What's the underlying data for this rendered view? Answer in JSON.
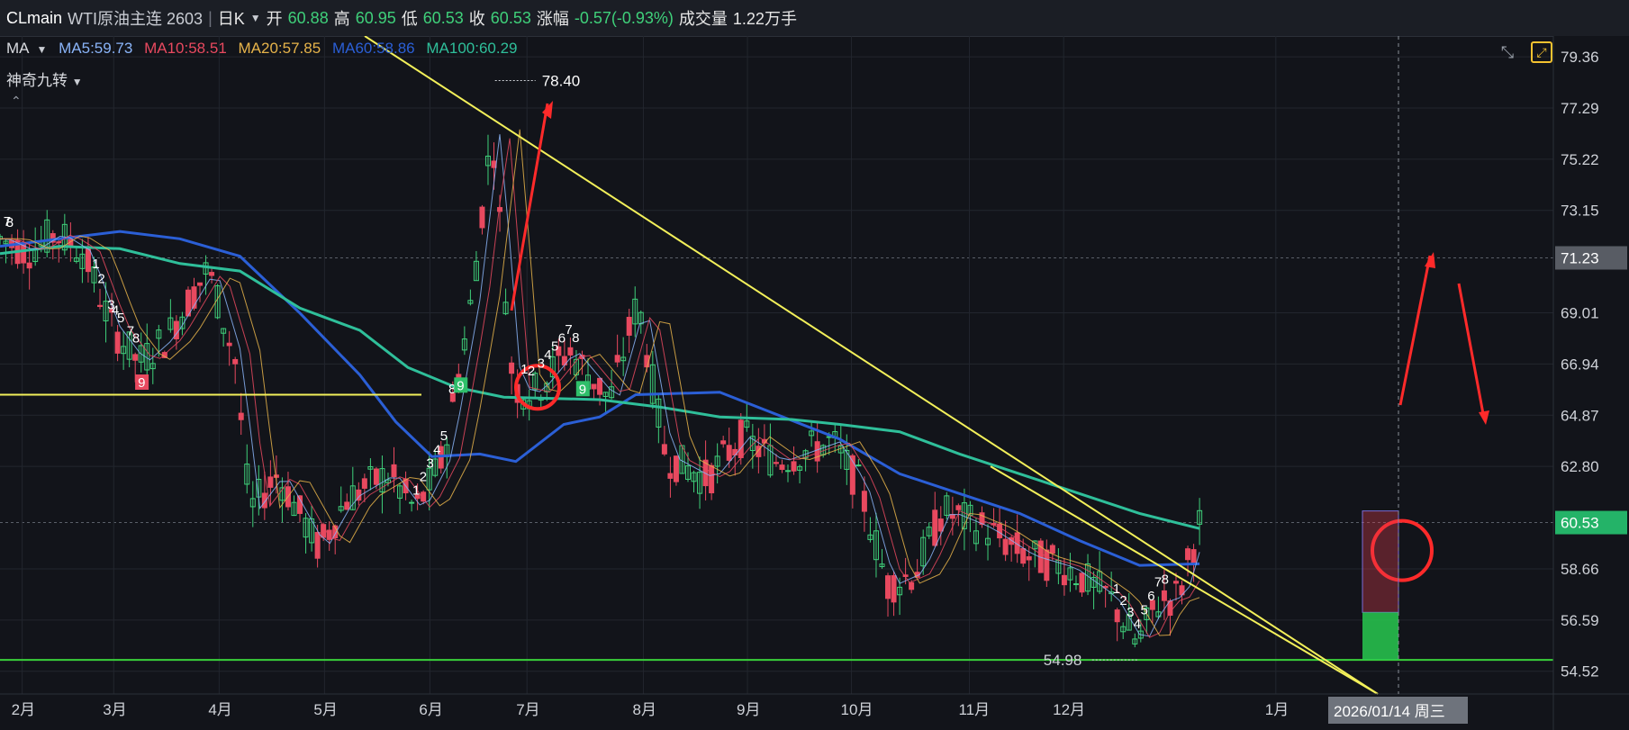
{
  "header": {
    "symbol": "CLmain",
    "name": "WTI原油主连 2603",
    "separator": "|",
    "period": "日K",
    "open_label": "开",
    "open": "60.88",
    "high_label": "高",
    "high": "60.95",
    "low_label": "低",
    "low": "60.53",
    "close_label": "收",
    "close": "60.53",
    "change_label": "涨幅",
    "change": "-0.57(-0.93%)",
    "volume_label": "成交量",
    "volume": "1.22万手"
  },
  "indicators": {
    "ma_label": "MA",
    "ma5": "MA5:59.73",
    "ma10": "MA10:58.51",
    "ma20": "MA20:57.85",
    "ma60": "MA60:58.86",
    "ma100": "MA100:60.29",
    "td_label": "神奇九转",
    "collapse_icon": "chevron-up-icon"
  },
  "colors": {
    "background": "#12141a",
    "up": "#3fd07a",
    "down": "#e8495f",
    "ma5": "#8ab4f8",
    "ma10": "#e8495f",
    "ma20": "#e6b34a",
    "ma60": "#2b5fd6",
    "ma100": "#2fbf9a",
    "trendline": "#f3f05a",
    "support": "#3ad13a",
    "annotation": "#ff2a2a"
  },
  "chart_data": {
    "type": "line",
    "ylim": [
      53.6,
      80.2
    ],
    "y_ticks": [
      "79.36",
      "77.29",
      "75.22",
      "73.15",
      "71.23",
      "69.01",
      "66.94",
      "64.87",
      "62.80",
      "60.53",
      "58.66",
      "56.59",
      "54.52"
    ],
    "highlighted_prices": [
      "71.23",
      "60.53"
    ],
    "x_ticks": [
      "2月",
      "3月",
      "4月",
      "5月",
      "6月",
      "7月",
      "8月",
      "9月",
      "10月",
      "11月",
      "12月",
      "1月"
    ],
    "crosshair_date": "2026/01/14 周三",
    "max_label": "78.40",
    "min_label": "54.98",
    "support_level": 54.98,
    "series": [
      {
        "name": "MA60",
        "x": [
          0,
          0.05,
          0.1,
          0.15,
          0.2,
          0.25,
          0.3,
          0.33,
          0.36,
          0.4,
          0.43,
          0.47,
          0.5,
          0.53,
          0.6,
          0.7,
          0.75,
          0.8,
          0.85,
          0.9,
          0.95,
          1.0
        ],
        "values": [
          71.7,
          72.0,
          72.3,
          72.0,
          71.3,
          69.0,
          66.5,
          64.6,
          63.2,
          63.3,
          63.0,
          64.5,
          64.8,
          65.7,
          65.8,
          63.9,
          62.5,
          61.7,
          60.9,
          59.8,
          58.8,
          58.86
        ]
      },
      {
        "name": "MA100",
        "x": [
          0,
          0.05,
          0.1,
          0.15,
          0.2,
          0.25,
          0.3,
          0.34,
          0.38,
          0.42,
          0.5,
          0.55,
          0.6,
          0.66,
          0.7,
          0.75,
          0.8,
          0.85,
          0.9,
          0.95,
          1.0
        ],
        "values": [
          71.4,
          71.7,
          71.6,
          71.0,
          70.7,
          69.2,
          68.3,
          66.8,
          66.0,
          65.6,
          65.5,
          65.2,
          64.8,
          64.7,
          64.5,
          64.2,
          63.3,
          62.5,
          61.7,
          60.9,
          60.29
        ]
      },
      {
        "name": "MA5",
        "x": [],
        "values": []
      }
    ],
    "candles_ohlc": "approx_daily",
    "td_marks": [
      {
        "x": 0.005,
        "text": "7"
      },
      {
        "x": 0.007,
        "text": "8"
      },
      {
        "x": 0.069,
        "text": "1"
      },
      {
        "x": 0.073,
        "text": "2"
      },
      {
        "x": 0.08,
        "text": "3"
      },
      {
        "x": 0.083,
        "text": "4"
      },
      {
        "x": 0.087,
        "text": "5"
      },
      {
        "x": 0.094,
        "text": "7"
      },
      {
        "x": 0.098,
        "text": "8"
      },
      {
        "x": 0.102,
        "text": "9"
      },
      {
        "x": 0.3,
        "text": "1"
      },
      {
        "x": 0.305,
        "text": "2"
      },
      {
        "x": 0.31,
        "text": "3"
      },
      {
        "x": 0.315,
        "text": "4"
      },
      {
        "x": 0.32,
        "text": "5"
      },
      {
        "x": 0.326,
        "text": "8"
      },
      {
        "x": 0.332,
        "text": "9"
      },
      {
        "x": 0.378,
        "text": "1"
      },
      {
        "x": 0.383,
        "text": "2"
      },
      {
        "x": 0.39,
        "text": "3"
      },
      {
        "x": 0.395,
        "text": "4"
      },
      {
        "x": 0.4,
        "text": "5"
      },
      {
        "x": 0.405,
        "text": "6"
      },
      {
        "x": 0.41,
        "text": "7"
      },
      {
        "x": 0.415,
        "text": "8"
      },
      {
        "x": 0.42,
        "text": "9"
      },
      {
        "x": 0.805,
        "text": "1"
      },
      {
        "x": 0.81,
        "text": "2"
      },
      {
        "x": 0.815,
        "text": "3"
      },
      {
        "x": 0.82,
        "text": "4"
      },
      {
        "x": 0.825,
        "text": "5"
      },
      {
        "x": 0.83,
        "text": "6"
      },
      {
        "x": 0.835,
        "text": "7"
      },
      {
        "x": 0.84,
        "text": "8"
      }
    ]
  }
}
